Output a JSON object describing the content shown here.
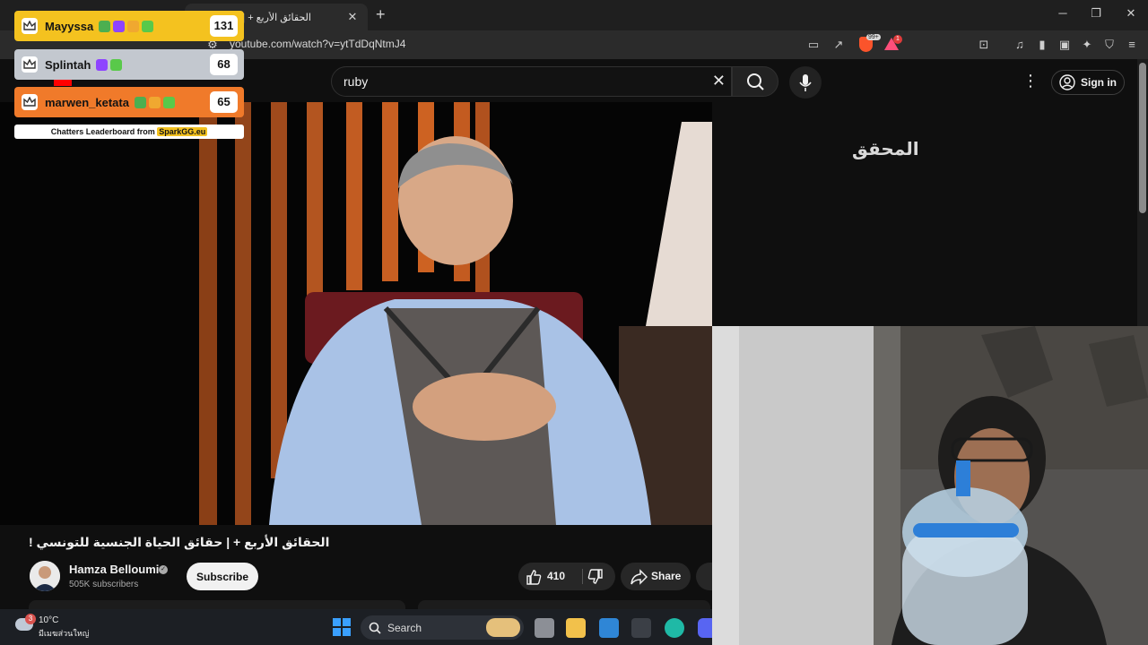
{
  "browser": {
    "tab_title": "الحقائق الأربع + | حقائق ال...",
    "url": "youtube.com/watch?v=ytTdDqNtmJ4",
    "shield_count": "99+",
    "alert_count": "1"
  },
  "youtube": {
    "search_query": "ruby",
    "sign_in_label": "Sign in",
    "channel_watermark": "المحقق",
    "video_title": "الحقائق الأربع + | حقائق الحياة الجنسية للتونسي !",
    "channel_name": "Hamza Belloumi",
    "subscribers": "505K subscribers",
    "subscribe_label": "Subscribe",
    "like_count": "410",
    "share_label": "Share"
  },
  "leaderboard": {
    "entries": [
      {
        "name": "Mayyssa",
        "score": "131",
        "color": "#f4c21f"
      },
      {
        "name": "Splintah",
        "score": "68",
        "color": "#c3c8cf"
      },
      {
        "name": "marwen_ketata",
        "score": "65",
        "color": "#f07a2a"
      }
    ],
    "footer_prefix": "Chatters Leaderboard from",
    "footer_brand": "SparkGG.eu"
  },
  "taskbar": {
    "temperature": "10°C",
    "weather_desc": "มีเมฆส่วนใหญ่",
    "weather_badge": "3",
    "search_label": "Search"
  }
}
